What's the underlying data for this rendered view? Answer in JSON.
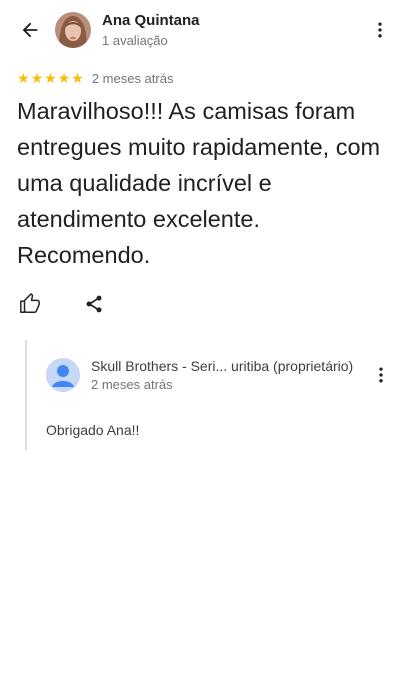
{
  "header": {
    "reviewer_name": "Ana Quintana",
    "reviewer_review_count": "1 avaliação",
    "back_icon": "arrow-back-icon",
    "more_icon": "more-vert-icon"
  },
  "review": {
    "rating": 5,
    "rating_max": 5,
    "star_color": "#fbbc04",
    "date": "2 meses atrás",
    "text": "Maravilhoso!!! As camisas foram entregues muito rapidamente, com uma qualidade incrível e atendimento excelente. Recomendo.",
    "like_icon": "thumb-up-icon",
    "share_icon": "share-icon"
  },
  "owner_response": {
    "name": "Skull Brothers - Seri... uritiba (proprietário)",
    "date": "2 meses atrás",
    "text": "Obrigado Ana!!",
    "avatar_icon": "default-avatar-icon"
  }
}
